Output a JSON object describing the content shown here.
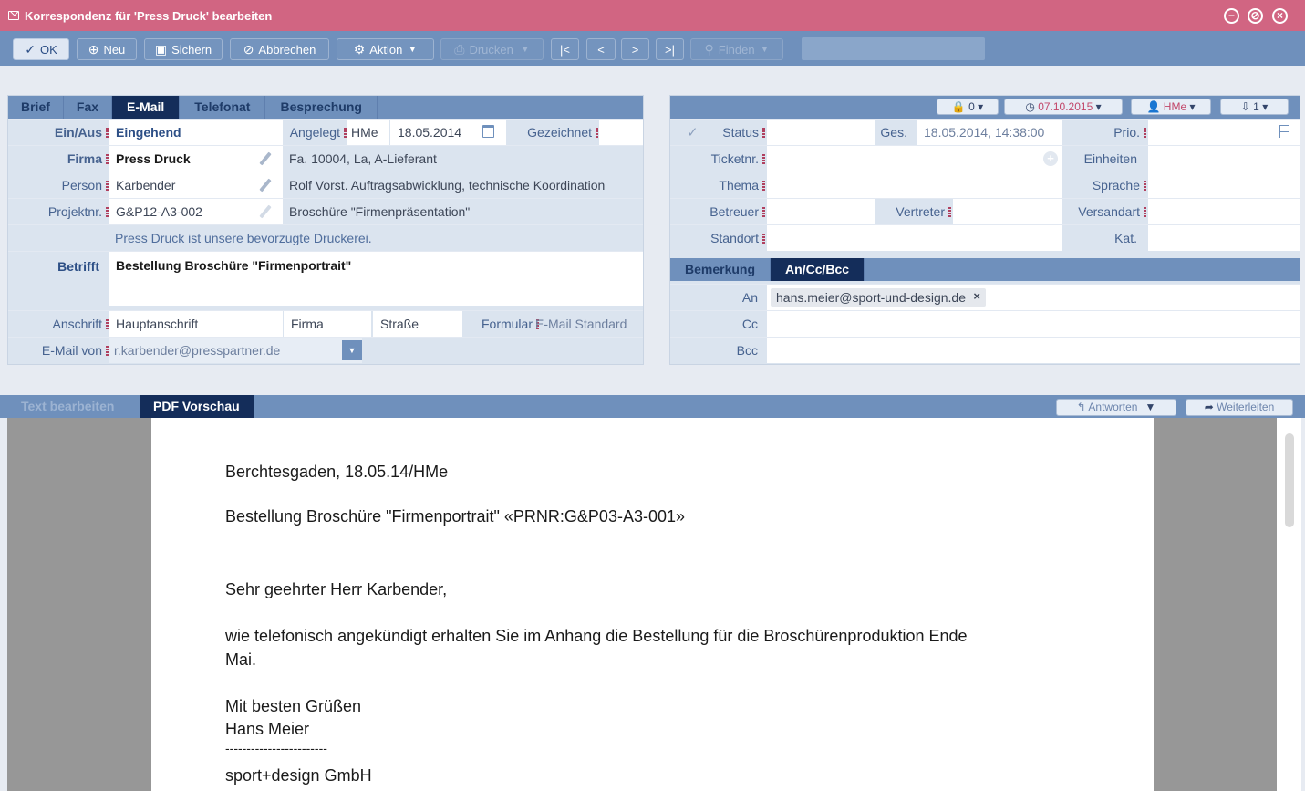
{
  "window": {
    "title": "Korrespondenz für 'Press Druck' bearbeiten"
  },
  "toolbar": {
    "ok": "OK",
    "new": "Neu",
    "save": "Sichern",
    "cancel": "Abbrechen",
    "action": "Aktion",
    "print": "Drucken",
    "find": "Finden",
    "search_value": ""
  },
  "left_tabs": [
    "Brief",
    "Fax",
    "E-Mail",
    "Telefonat",
    "Besprechung"
  ],
  "form": {
    "einaus_label": "Ein/Aus",
    "einaus_value": "Eingehend",
    "angelegt_label": "Angelegt",
    "angelegt_user": "HMe",
    "angelegt_date": "18.05.2014",
    "gezeichnet_label": "Gezeichnet",
    "firma_label": "Firma",
    "firma_value": "Press Druck",
    "firma_info": "Fa. 10004, La, A-Lieferant",
    "person_label": "Person",
    "person_value": "Karbender",
    "person_info": "Rolf Vorst. Auftragsabwicklung, technische Koordination",
    "projekt_label": "Projektnr.",
    "projekt_value": "G&P12-A3-002",
    "projekt_info": "Broschüre \"Firmenpräsentation\"",
    "note": "Press Druck ist unsere bevorzugte Druckerei.",
    "betrifft_label": "Betrifft",
    "betrifft_value": "Bestellung Broschüre \"Firmenportrait\"",
    "anschrift_label": "Anschrift",
    "anschrift_value": "Hauptanschrift",
    "firma2": "Firma",
    "strasse": "Straße",
    "formular_label": "Formular",
    "formular_value": "E-Mail Standard",
    "emailvon_label": "E-Mail von",
    "emailvon_value": "r.karbender@presspartner.de"
  },
  "right_header": {
    "lock": "0",
    "date": "07.10.2015",
    "user": "HMe",
    "count": "1"
  },
  "right_form": {
    "status_label": "Status",
    "ges_label": "Ges.",
    "ges_value": "18.05.2014, 14:38:00",
    "prio_label": "Prio.",
    "ticket_label": "Ticketnr.",
    "einheiten_label": "Einheiten",
    "thema_label": "Thema",
    "sprache_label": "Sprache",
    "betreuer_label": "Betreuer",
    "vertreter_label": "Vertreter",
    "versandart_label": "Versandart",
    "standort_label": "Standort",
    "kat_label": "Kat."
  },
  "right_tabs": [
    "Bemerkung",
    "An/Cc/Bcc"
  ],
  "recipients": {
    "an_label": "An",
    "an_value": "hans.meier@sport-und-design.de",
    "cc_label": "Cc",
    "bcc_label": "Bcc"
  },
  "bottom_tabs": [
    "Text bearbeiten",
    "PDF Vorschau"
  ],
  "bottom_actions": {
    "reply": "Antworten",
    "forward": "Weiterleiten"
  },
  "document": {
    "line1": "Berchtesgaden, 18.05.14/HMe",
    "line2": "Bestellung Broschüre \"Firmenportrait\" «PRNR:G&P03-A3-001»",
    "line3": "Sehr geehrter Herr Karbender,",
    "line4": "wie telefonisch angekündigt erhalten Sie im Anhang die Bestellung für die Broschürenproduktion Ende",
    "line5": "Mai.",
    "line6": "Mit besten Grüßen",
    "line7": "Hans Meier",
    "line8": "------------------------",
    "line9": "sport+design GmbH"
  }
}
